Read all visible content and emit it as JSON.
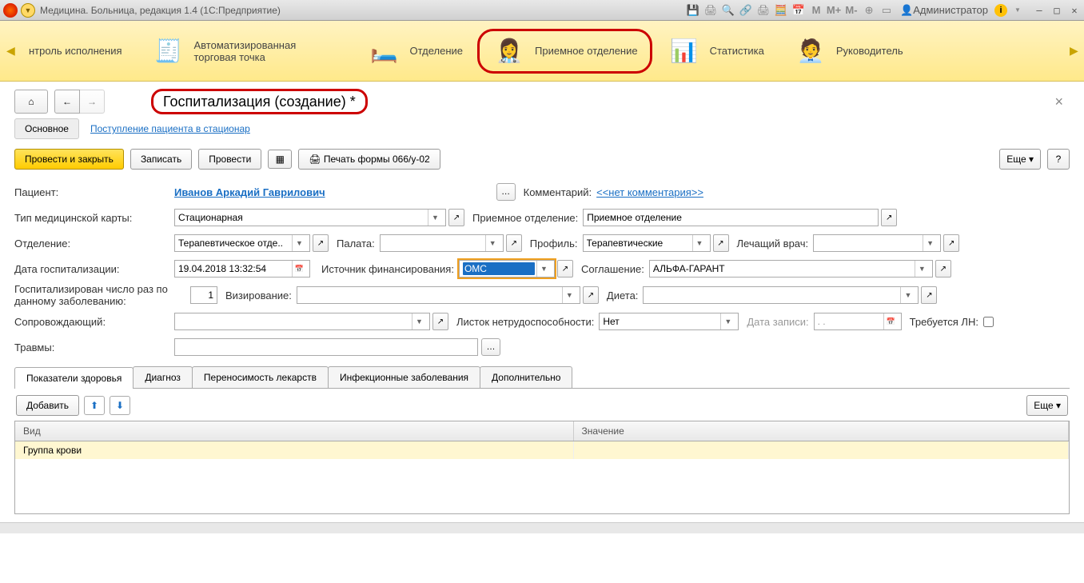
{
  "titlebar": {
    "title": "Медицина. Больница, редакция 1.4  (1С:Предприятие)",
    "user": " Администратор"
  },
  "sections": {
    "s1": "нтроль исполнения",
    "s2": "Автоматизированная торговая точка",
    "s3": "Отделение",
    "s4": "Приемное отделение",
    "s5": "Статистика",
    "s6": "Руководитель"
  },
  "page": {
    "title": "Госпитализация (создание) *",
    "tab_main": "Основное",
    "tab_link": "Поступление пациента в стационар"
  },
  "buttons": {
    "post_close": "Провести и закрыть",
    "save": "Записать",
    "post": "Провести",
    "print": "Печать формы 066/у-02",
    "more": "Еще",
    "add": "Добавить"
  },
  "labels": {
    "patient": "Пациент:",
    "comment": "Комментарий:",
    "card_type": "Тип медицинской карты:",
    "admission_dept": "Приемное отделение:",
    "dept": "Отделение:",
    "ward": "Палата:",
    "profile": "Профиль:",
    "doctor": "Лечащий врач:",
    "hosp_date": "Дата госпитализации:",
    "fin_source": "Источник финансирования:",
    "agreement": "Соглашение:",
    "hosp_count": "Госпитализирован число раз по данному заболеванию:",
    "vising": "Визирование:",
    "diet": "Диета:",
    "escort": "Сопровождающий:",
    "sick_leave": "Листок нетрудоспособности:",
    "rec_date": "Дата записи:",
    "need_ln": "Требуется ЛН:",
    "injuries": "Травмы:"
  },
  "values": {
    "patient_link": "Иванов Аркадий Гаврилович",
    "comment_link": "<<нет комментария>>",
    "card_type": "Стационарная",
    "admission_dept": "Приемное отделение",
    "dept": "Терапевтическое отде..",
    "profile": "Терапевтические",
    "hosp_date": "19.04.2018 13:32:54",
    "fin_source": "ОМС",
    "agreement": "АЛЬФА-ГАРАНТ",
    "hosp_count": "1",
    "sick_leave": "Нет",
    "rec_date": "  .  .    "
  },
  "subtabs": {
    "t1": "Показатели здоровья",
    "t2": "Диагноз",
    "t3": "Переносимость лекарств",
    "t4": "Инфекционные заболевания",
    "t5": "Дополнительно"
  },
  "table": {
    "col1": "Вид",
    "col2": "Значение",
    "row1_c1": "Группа крови"
  }
}
